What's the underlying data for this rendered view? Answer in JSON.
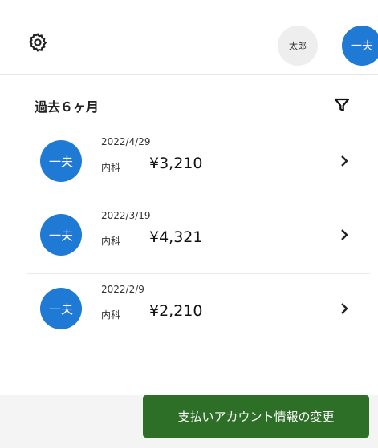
{
  "header": {
    "settings_icon": "gear-icon",
    "users": [
      {
        "label": "太郎",
        "active": false
      },
      {
        "label": "一夫",
        "active": true
      }
    ]
  },
  "main": {
    "period_label": "過去６ヶ月",
    "filter_icon": "filter-icon",
    "history": [
      {
        "avatar": "一夫",
        "date": "2022/4/29",
        "department": "内科",
        "amount": "¥3,210"
      },
      {
        "avatar": "一夫",
        "date": "2022/3/19",
        "department": "内科",
        "amount": "¥4,321"
      },
      {
        "avatar": "一夫",
        "date": "2022/2/9",
        "department": "内科",
        "amount": "¥2,210"
      }
    ]
  },
  "footer": {
    "change_payment_label": "支払いアカウント情報の変更"
  },
  "colors": {
    "accent_blue": "#1f7ad6",
    "button_green": "#2e6f28"
  }
}
